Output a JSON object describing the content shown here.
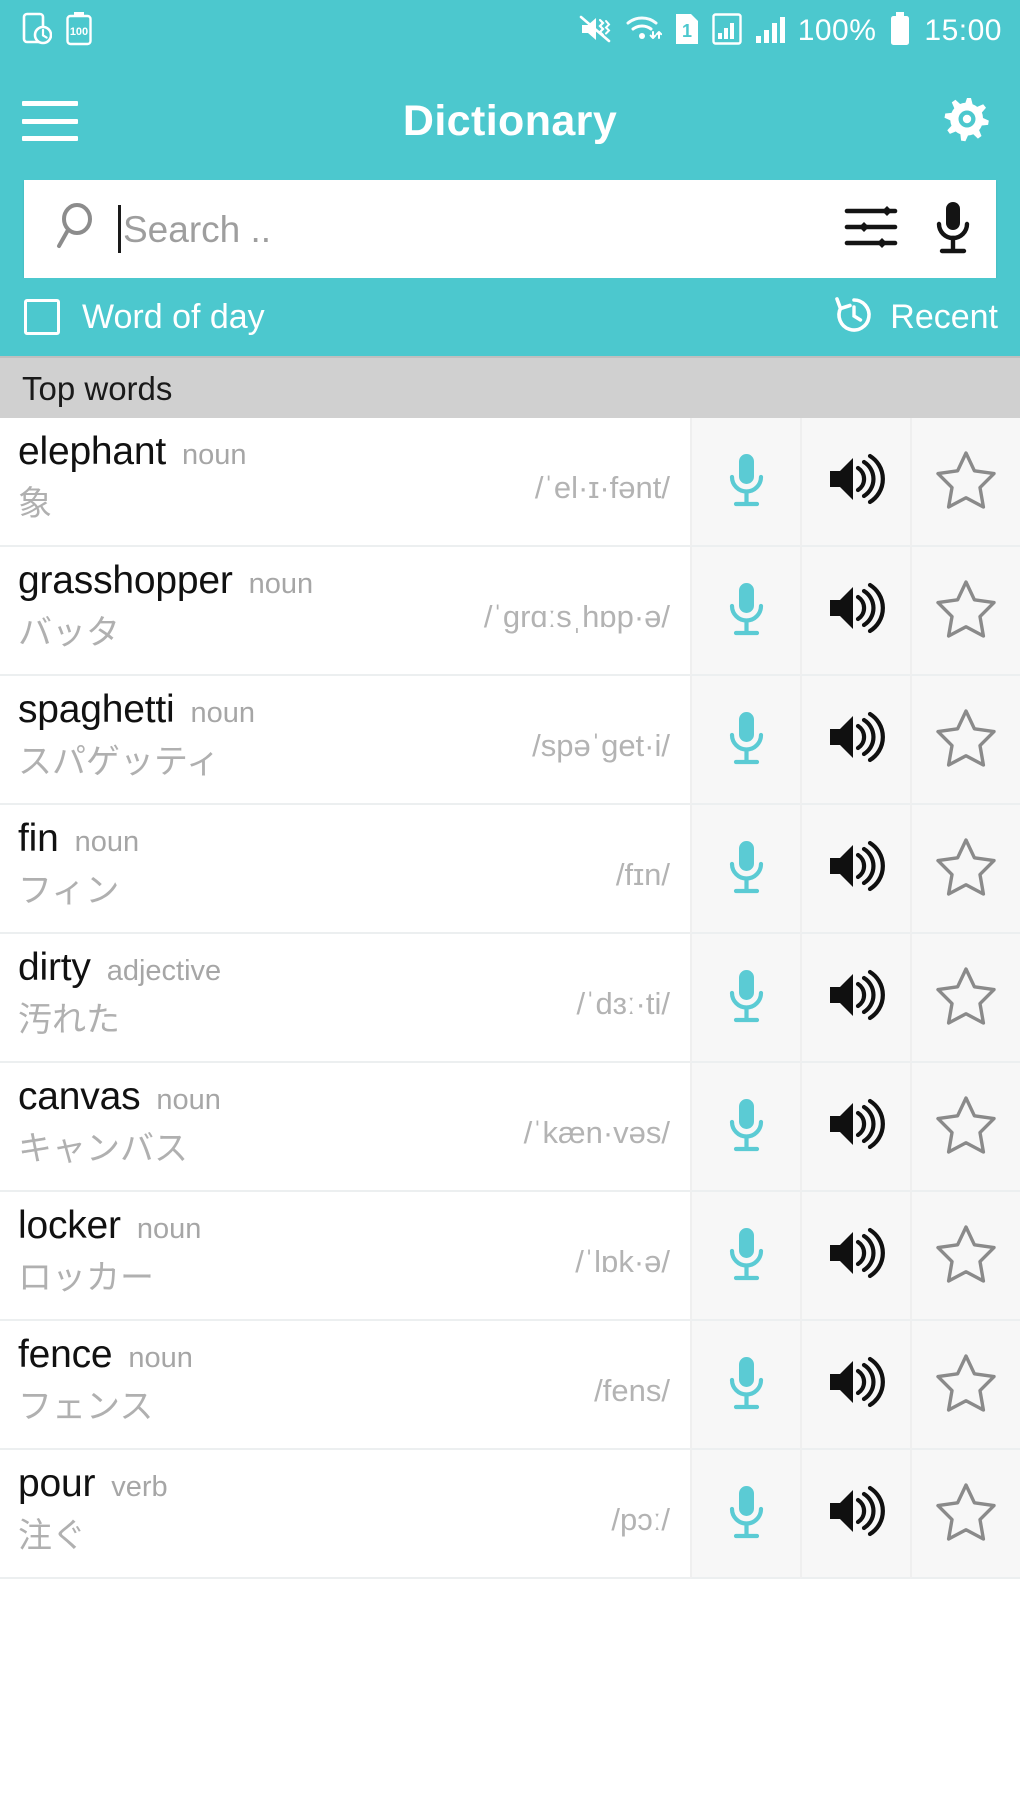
{
  "statusbar": {
    "left_icons": [
      "screen-timeout-icon",
      "battery-saver-100-icon"
    ],
    "right_icons": [
      "mute-vibrate-icon",
      "wifi-icon",
      "sim-1-icon",
      "signal-boxed-icon",
      "signal-bars-icon",
      "battery-icon"
    ],
    "battery_percent": "100%",
    "sim_label": "1",
    "battery_saver_label": "100",
    "time": "15:00"
  },
  "appbar": {
    "menu_icon": "hamburger-menu-icon",
    "title": "Dictionary",
    "settings_icon": "gear-icon"
  },
  "search": {
    "placeholder": "Search ..",
    "value": "",
    "search_icon": "magnifier-icon",
    "filter_icon": "sliders-filter-icon",
    "mic_icon": "microphone-icon"
  },
  "options": {
    "word_of_day_label": "Word of day",
    "word_of_day_checked": false,
    "recent_label": "Recent",
    "recent_icon": "history-clock-icon"
  },
  "section": {
    "top_words_label": "Top words"
  },
  "colors": {
    "accent_teal": "#4CC8CE",
    "mic_teal": "#5BCBD4",
    "section_gray": "#D0D0D0",
    "action_bg": "#F7F7F7",
    "muted_text": "#B0B0B0"
  },
  "actions": {
    "mic_label": "microphone-icon",
    "speaker_label": "speaker-icon",
    "star_label": "star-outline-icon"
  },
  "words": [
    {
      "term": "elephant",
      "pos": "noun",
      "ipa": "/ˈel·ɪ·fənt/",
      "translation": "象"
    },
    {
      "term": "grasshopper",
      "pos": "noun",
      "ipa": "/ˈɡrɑːsˌhɒp·ə/",
      "translation": "バッタ"
    },
    {
      "term": "spaghetti",
      "pos": "noun",
      "ipa": "/spəˈɡet·i/",
      "translation": "スパゲッティ"
    },
    {
      "term": "fin",
      "pos": "noun",
      "ipa": "/fɪn/",
      "translation": "フィン"
    },
    {
      "term": "dirty",
      "pos": "adjective",
      "ipa": "/ˈdɜː·ti/",
      "translation": "汚れた"
    },
    {
      "term": "canvas",
      "pos": "noun",
      "ipa": "/ˈkæn·vəs/",
      "translation": "キャンバス"
    },
    {
      "term": "locker",
      "pos": "noun",
      "ipa": "/ˈlɒk·ə/",
      "translation": "ロッカー"
    },
    {
      "term": "fence",
      "pos": "noun",
      "ipa": "/fens/",
      "translation": "フェンス"
    },
    {
      "term": "pour",
      "pos": "verb",
      "ipa": "/pɔː/",
      "translation": "注ぐ"
    }
  ]
}
